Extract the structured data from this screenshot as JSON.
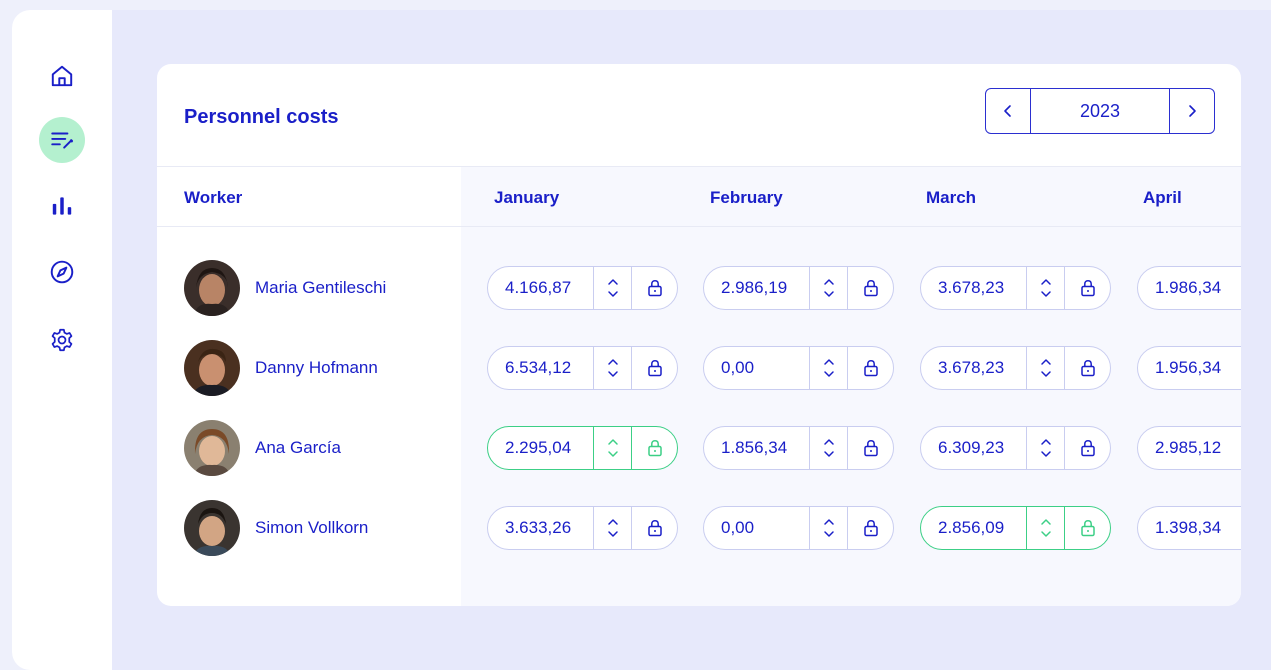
{
  "sidebar": {
    "items": [
      {
        "icon": "home-icon",
        "active": false
      },
      {
        "icon": "edit-list-icon",
        "active": true
      },
      {
        "icon": "bar-chart-icon",
        "active": false
      },
      {
        "icon": "compass-icon",
        "active": false
      },
      {
        "icon": "gear-icon",
        "active": false
      }
    ]
  },
  "card": {
    "title": "Personnel costs",
    "year": "2023",
    "worker_header": "Worker",
    "months": [
      "January",
      "February",
      "March",
      "April"
    ]
  },
  "rows": [
    {
      "name": "Maria Gentileschi",
      "values": [
        "4.166,87",
        "2.986,19",
        "3.678,23",
        "1.986,34"
      ],
      "locked": [
        false,
        false,
        false,
        false
      ]
    },
    {
      "name": "Danny Hofmann",
      "values": [
        "6.534,12",
        "0,00",
        "3.678,23",
        "1.956,34"
      ],
      "locked": [
        false,
        false,
        false,
        false
      ]
    },
    {
      "name": "Ana García",
      "values": [
        "2.295,04",
        "1.856,34",
        "6.309,23",
        "2.985,12"
      ],
      "locked": [
        true,
        false,
        false,
        false
      ]
    },
    {
      "name": "Simon Vollkorn",
      "values": [
        "3.633,26",
        "0,00",
        "2.856,09",
        "1.398,34"
      ],
      "locked": [
        false,
        false,
        true,
        false
      ]
    }
  ],
  "colors": {
    "accent": "#1a1fc8",
    "active_nav": "#b4f0cf",
    "locked": "#3ccf86",
    "border": "#c9cdf0"
  }
}
